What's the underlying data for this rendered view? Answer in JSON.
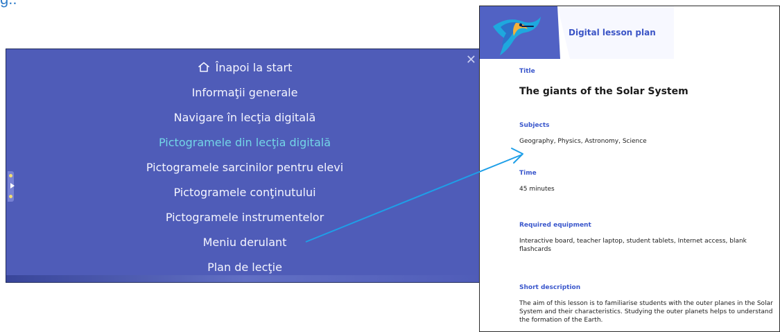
{
  "page_fragment": {
    "text": "g.."
  },
  "menu": {
    "items": [
      {
        "label": "Înapoi la start",
        "icon": "home-icon",
        "active": false
      },
      {
        "label": "Informaţii generale",
        "active": false
      },
      {
        "label": "Navigare în lecţia digitală",
        "active": false
      },
      {
        "label": "Pictogramele din lecţia digitală",
        "active": true
      },
      {
        "label": "Pictogramele sarcinilor pentru elevi",
        "active": false
      },
      {
        "label": "Pictogramele conţinutului",
        "active": false
      },
      {
        "label": "Pictogramele instrumentelor",
        "active": false
      },
      {
        "label": "Meniu derulant",
        "active": false
      },
      {
        "label": "Plan de lecţie",
        "active": false
      }
    ],
    "close_icon": "close-icon",
    "colors": {
      "background": "#4F5CB8",
      "active": "#73D6E7",
      "text": "#F4F5FF"
    }
  },
  "document": {
    "header_title": "Digital lesson plan",
    "bird_icon": "hummingbird-icon",
    "sections": {
      "title": {
        "label": "Title",
        "value": "The giants of the Solar System"
      },
      "subjects": {
        "label": "Subjects",
        "value": "Geography, Physics, Astronomy, Science"
      },
      "time": {
        "label": "Time",
        "value": "45 minutes"
      },
      "equipment": {
        "label": "Required equipment",
        "value": "Interactive board, teacher laptop, student tablets, Internet access, blank flashcards"
      },
      "description": {
        "label": "Short description",
        "value": "The aim of this lesson is to familiarise students with the outer planes in the Solar System and their characteristics. Studying the outer planets helps to understand the formation of the Earth."
      }
    },
    "colors": {
      "label": "#3A57CC",
      "header_band": "#5162C4"
    }
  },
  "overlay": {
    "arrow_color": "#1E9FE8"
  }
}
